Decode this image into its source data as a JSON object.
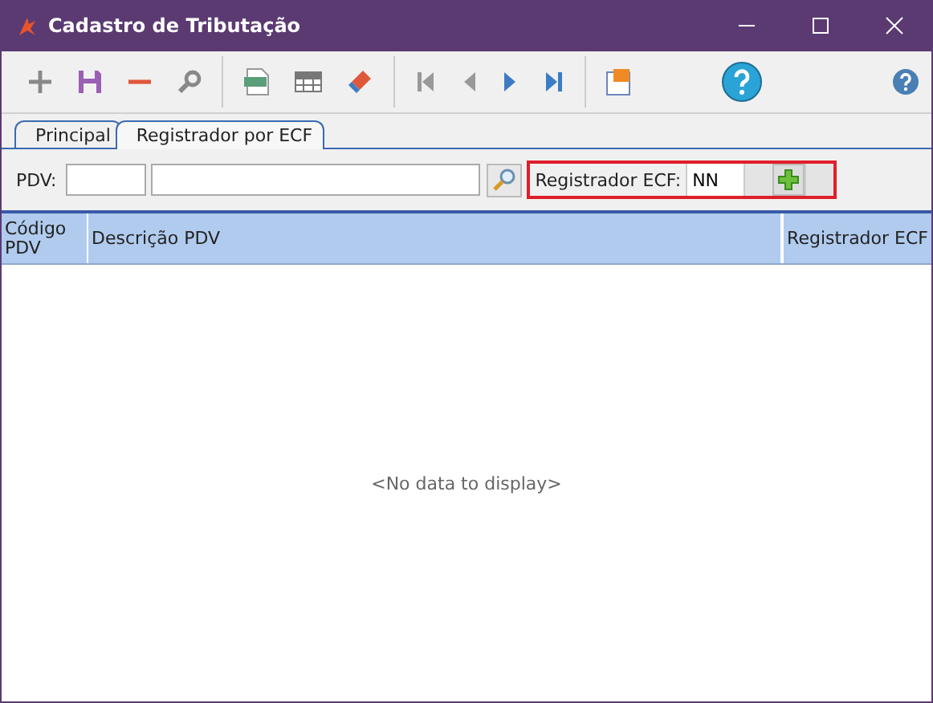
{
  "window": {
    "title": "Cadastro de Tributação"
  },
  "tabs": [
    {
      "label": "Principal",
      "selected": false
    },
    {
      "label": "Registrador por ECF",
      "selected": true
    }
  ],
  "filter": {
    "pdv_label": "PDV:",
    "registrador_label": "Registrador ECF:",
    "registrador_value": "NN"
  },
  "grid": {
    "columns": [
      {
        "label": "Código PDV",
        "kind": "narrow"
      },
      {
        "label": "Descrição PDV",
        "kind": "wide"
      },
      {
        "label": "Registrador ECF",
        "kind": "right"
      }
    ],
    "empty_text": "<No data to display>"
  }
}
